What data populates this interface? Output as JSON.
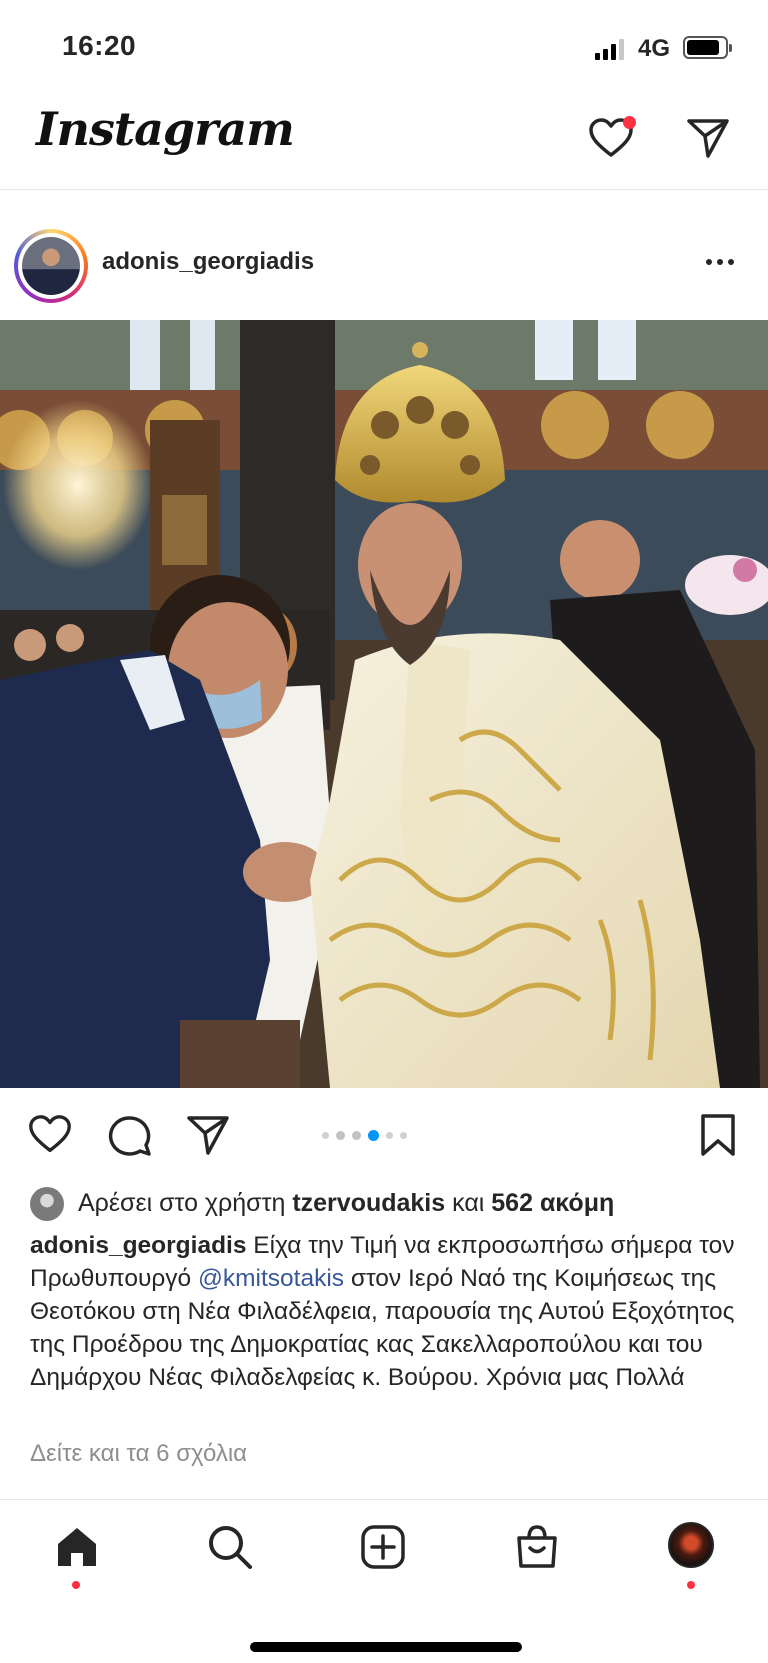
{
  "status_bar": {
    "time": "16:20",
    "network": "4G"
  },
  "header": {
    "logo": "Instagram",
    "has_notification": true
  },
  "post": {
    "username": "adonis_georgiadis",
    "carousel": {
      "count": 6,
      "active_index": 3
    },
    "liked_by_prefix": "Αρέσει στο χρήστη",
    "liked_by_user": "tzervoudakis",
    "liked_by_joiner": "και",
    "liked_by_others": "562 ακόμη",
    "caption_user": "adonis_georgiadis",
    "caption_part1": "Είχα την Τιμή να εκπροσωπήσω σήμερα τον Πρωθυπουργό",
    "caption_mention": "@kmitsotakis",
    "caption_part2": "στον Ιερό Ναό της Κοιμήσεως της Θεοτόκου στη Νέα Φιλαδέλφεια, παρουσία της Αυτού Εξοχότητος της Προέδρου της Δημοκρατίας κας Σακελλαροπούλου και του Δημάρχου Νέας Φιλαδελφείας κ. Βούρου. Χρόνια μας Πολλά",
    "view_comments": "Δείτε και τα 6 σχόλια"
  },
  "bottom_nav": {
    "items": [
      "home-icon",
      "search-icon",
      "new-post-icon",
      "shop-icon",
      "profile-avatar"
    ],
    "active": "home-icon"
  },
  "colors": {
    "text": "#262626",
    "secondary": "#8e8e8e",
    "mention": "#385898",
    "accent_blue": "#0095f6",
    "notification_red": "#ff3040"
  }
}
